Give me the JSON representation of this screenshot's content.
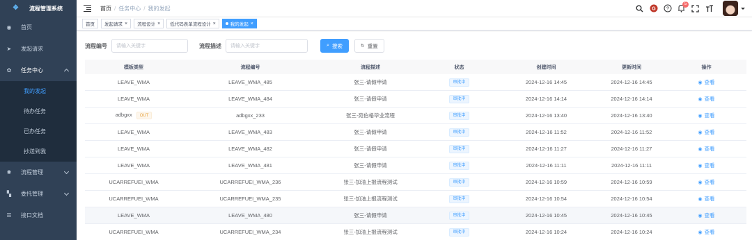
{
  "app": {
    "title": "流程管理系统"
  },
  "sidebar": {
    "items": [
      {
        "label": "首页",
        "icon": "dashboard-icon"
      },
      {
        "label": "发起请求",
        "icon": "send-icon"
      },
      {
        "label": "任务中心",
        "icon": "task-icon",
        "children": [
          {
            "label": "我的发起",
            "active": true
          },
          {
            "label": "待办任务"
          },
          {
            "label": "已办任务"
          },
          {
            "label": "抄送到我"
          }
        ]
      },
      {
        "label": "流程管理",
        "icon": "gear-icon"
      },
      {
        "label": "委托管理",
        "icon": "delegate-icon"
      },
      {
        "label": "接口文档",
        "icon": "doc-icon"
      }
    ]
  },
  "breadcrumb": [
    "首页",
    "任务中心",
    "我的发起"
  ],
  "header": {
    "notification_count": "5"
  },
  "tags": [
    {
      "label": "首页",
      "closable": false
    },
    {
      "label": "发起请求",
      "closable": true
    },
    {
      "label": "流程设计",
      "closable": true
    },
    {
      "label": "低代码表单流程设计",
      "closable": true
    },
    {
      "label": "我的发起",
      "closable": true,
      "active": true
    }
  ],
  "search": {
    "code_label": "流程编号",
    "code_placeholder": "请输入关键字",
    "desc_label": "流程描述",
    "desc_placeholder": "请输入关键字",
    "search_button": "搜索",
    "reset_button": "重置"
  },
  "table": {
    "columns": [
      "模板类型",
      "流程编号",
      "流程描述",
      "状态",
      "创建时间",
      "更新时间",
      "操作"
    ],
    "view_label": "查看",
    "rows": [
      {
        "type": "LEAVE_WMA",
        "code": "LEAVE_WMA_485",
        "desc": "张三-请假申请",
        "status": "审批中",
        "created": "2024-12-16 14:45",
        "updated": "2024-12-16 14:45"
      },
      {
        "type": "LEAVE_WMA",
        "code": "LEAVE_WMA_484",
        "desc": "张三-请假申请",
        "status": "审批中",
        "created": "2024-12-16 14:14",
        "updated": "2024-12-16 14:14"
      },
      {
        "type": "adbgxx",
        "tag": "OUT",
        "code": "adbgxx_233",
        "desc": "张三-宛伯格毕业流程",
        "status": "审批中",
        "created": "2024-12-16 13:40",
        "updated": "2024-12-16 13:40"
      },
      {
        "type": "LEAVE_WMA",
        "code": "LEAVE_WMA_483",
        "desc": "张三-请假申请",
        "status": "审批中",
        "created": "2024-12-16 11:52",
        "updated": "2024-12-16 11:52"
      },
      {
        "type": "LEAVE_WMA",
        "code": "LEAVE_WMA_482",
        "desc": "张三-请假申请",
        "status": "审批中",
        "created": "2024-12-16 11:27",
        "updated": "2024-12-16 11:27"
      },
      {
        "type": "LEAVE_WMA",
        "code": "LEAVE_WMA_481",
        "desc": "张三-请假申请",
        "status": "审批中",
        "created": "2024-12-16 11:11",
        "updated": "2024-12-16 11:11"
      },
      {
        "type": "UCARREFUEI_WMA",
        "code": "UCARREFUEI_WMA_236",
        "desc": "张三-加油上报流程测试",
        "status": "审批中",
        "created": "2024-12-16 10:59",
        "updated": "2024-12-16 10:59"
      },
      {
        "type": "UCARREFUEI_WMA",
        "code": "UCARREFUEI_WMA_235",
        "desc": "张三-加油上报流程测试",
        "status": "审批中",
        "created": "2024-12-16 10:54",
        "updated": "2024-12-16 10:54"
      },
      {
        "type": "LEAVE_WMA",
        "code": "LEAVE_WMA_480",
        "desc": "张三-请假申请",
        "status": "审批中",
        "created": "2024-12-16 10:45",
        "updated": "2024-12-16 10:45",
        "highlight": true
      },
      {
        "type": "UCARREFUEI_WMA",
        "code": "UCARREFUEI_WMA_234",
        "desc": "张三-加油上报流程测试",
        "status": "审批中",
        "created": "2024-12-16 10:24",
        "updated": "2024-12-16 10:24"
      }
    ]
  },
  "colors": {
    "sidebar": "#304156",
    "submenu": "#1f2d3d",
    "primary": "#409eff",
    "badge": "#f56c6c"
  }
}
